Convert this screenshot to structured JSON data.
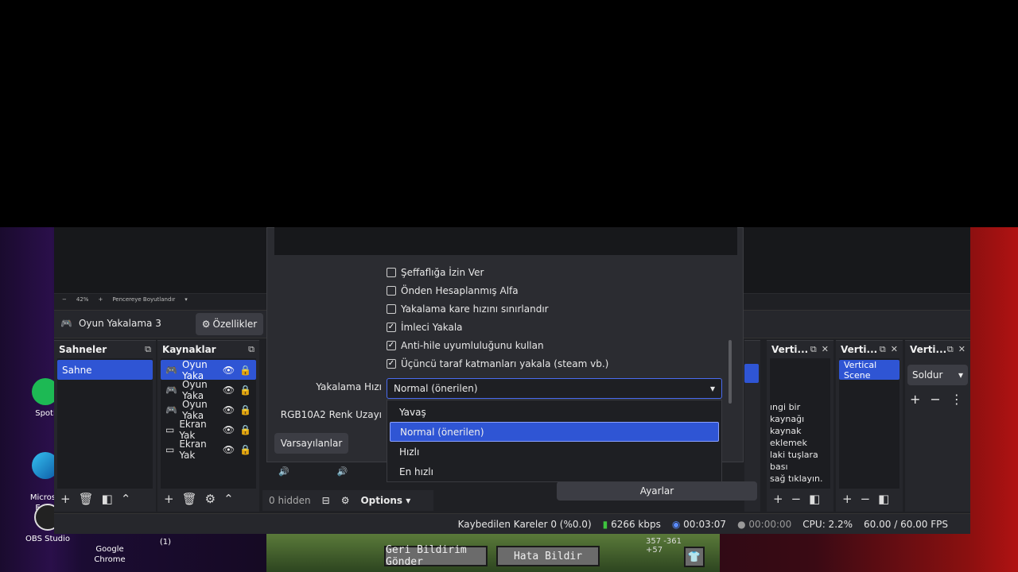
{
  "desktop": {
    "icons": [
      {
        "label": "Spoti"
      },
      {
        "label": "Microso\nEdge"
      },
      {
        "label": "OBS Studio"
      },
      {
        "label": "Google\nChrome"
      },
      {
        "label": "(1)"
      }
    ]
  },
  "preview": {
    "zoom_minus": "−",
    "zoom_value": "42%",
    "zoom_plus": "+",
    "fit_label": "Pencereye Boyutlandır"
  },
  "source_bar": {
    "source_name": "Oyun Yakalama 3",
    "properties_button": "Özellikler"
  },
  "scenes_dock": {
    "title": "Sahneler",
    "items": [
      "Sahne"
    ]
  },
  "sources_dock": {
    "title": "Kaynaklar",
    "items": [
      "Oyun Yaka",
      "Oyun Yaka",
      "Oyun Yaka",
      "Ekran Yak",
      "Ekran Yak"
    ],
    "hidden_label": "0 hidden",
    "options_label": "Options"
  },
  "vertical_docks": {
    "titles": [
      "Verti...",
      "Verti...",
      "Verti..."
    ],
    "empty_text": "ıngi bir kaynağı\nkaynak eklemek\nlaki tuşlara bası\nsağ tıklayın.",
    "scene_item": "Vertical Scene",
    "transition_select": "Soldur",
    "settings_button": "Ayarlar"
  },
  "dialog": {
    "checkboxes": [
      {
        "label": "Şeffaflığa İzin Ver",
        "checked": false
      },
      {
        "label": "Önden Hesaplanmış Alfa",
        "checked": false
      },
      {
        "label": "Yakalama kare hızını sınırlandır",
        "checked": false
      },
      {
        "label": "İmleci Yakala",
        "checked": true
      },
      {
        "label": "Anti-hile uyumluluğunu kullan",
        "checked": true
      },
      {
        "label": "Üçüncü taraf katmanları yakala (steam vb.)",
        "checked": true
      }
    ],
    "capture_rate_label": "Yakalama Hızı",
    "capture_rate_value": "Normal (önerilen)",
    "rgb_label": "RGB10A2 Renk Uzayı",
    "defaults_button": "Varsayılanlar",
    "options": [
      "Yavaş",
      "Normal (önerilen)",
      "Hızlı",
      "En hızlı"
    ],
    "selected_option_index": 1
  },
  "status_bar": {
    "dropped_frames": "Kaybedilen Kareler 0 (%0.0)",
    "bitrate": "6266 kbps",
    "stream_time": "00:03:07",
    "rec_time": "00:00:00",
    "cpu": "CPU: 2.2%",
    "fps": "60.00 / 60.00 FPS"
  },
  "game": {
    "feedback_button": "Geri Bildirim Gönder",
    "bug_button": "Hata Bildir",
    "coords": "357 -361\n+57"
  }
}
